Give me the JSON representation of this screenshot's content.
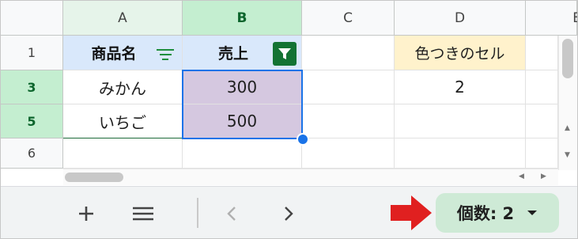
{
  "columns": [
    "A",
    "B",
    "C",
    "D",
    "E"
  ],
  "rows": [
    "1",
    "3",
    "5",
    "6"
  ],
  "table": {
    "header_a": "商品名",
    "header_b": "売上",
    "a3": "みかん",
    "b3": "300",
    "a5": "いちご",
    "b5": "500"
  },
  "d1": "色つきのセル",
  "d3": "2",
  "status": {
    "count_label": "個数: 2"
  },
  "colors": {
    "selection": "#1a73e8",
    "purple_fill": "#d5c8e0",
    "orange_fill": "#fff2cc",
    "filter_green": "#137333",
    "arrow_red": "#e02020"
  },
  "icons": [
    "filter-lines-icon",
    "filter-icon",
    "add-sheet-icon",
    "all-sheets-icon",
    "prev-sheet-icon",
    "next-sheet-icon",
    "dropdown-icon",
    "arrow-icon"
  ]
}
